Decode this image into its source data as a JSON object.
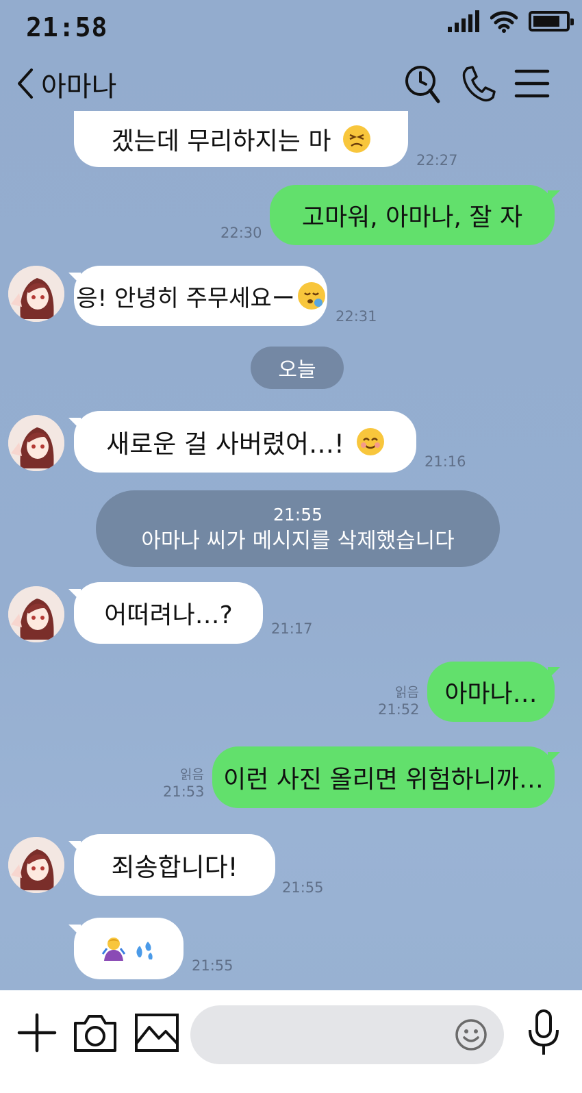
{
  "status_bar": {
    "time": "21:58"
  },
  "header": {
    "contact_name": "아마나"
  },
  "messages": [
    {
      "dir": "in",
      "text": "겠는데 무리하지는 마",
      "emoji": "tired-face-emoji",
      "time": "22:27"
    },
    {
      "dir": "out",
      "text": "고마워, 아마나, 잘 자",
      "time": "22:30"
    },
    {
      "dir": "in",
      "text": "응! 안녕히 주무세요ー",
      "emoji": "sleeping-face-emoji",
      "time": "22:31"
    },
    {
      "dir": "in",
      "text": "새로운 걸 사버렸어…!",
      "emoji": "smiling-face-emoji",
      "time": "21:16"
    },
    {
      "dir": "in",
      "text": "어떠려나…?",
      "time": "21:17"
    },
    {
      "dir": "out",
      "text": "아마나…",
      "read": "읽음",
      "time": "21:52"
    },
    {
      "dir": "out",
      "text": "이런 사진 올리면 위험하니까…",
      "read": "읽음",
      "time": "21:53"
    },
    {
      "dir": "in",
      "text": "죄송합니다!",
      "time": "21:55"
    },
    {
      "dir": "in",
      "text": "",
      "emoji": "bowing-person-emoji sweat-droplets-emoji",
      "time": "21:55"
    }
  ],
  "date_divider": "오늘",
  "system_notice": {
    "time": "21:55",
    "text": "아마나 씨가 메시지를 삭제했습니다"
  },
  "colors": {
    "background": "#93acce",
    "outgoing_bubble": "#62e06c",
    "incoming_bubble": "#ffffff",
    "system_pill": "#7388a3"
  }
}
